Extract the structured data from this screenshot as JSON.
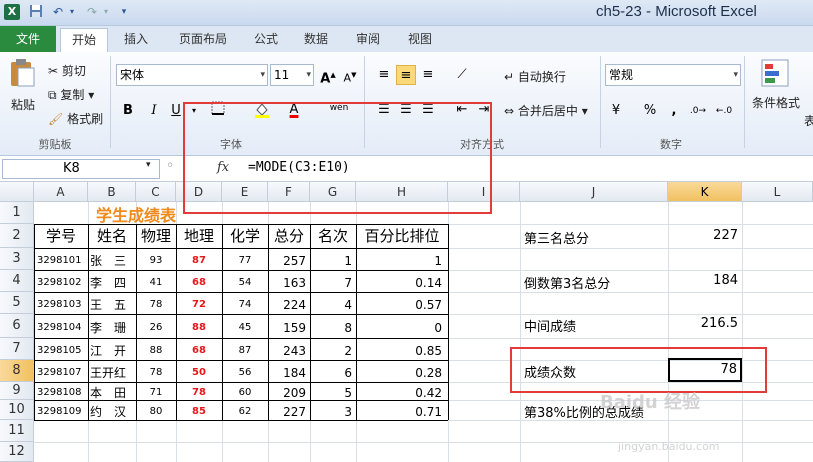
{
  "window": {
    "title": "ch5-23 - Microsoft Excel"
  },
  "tabs": [
    "文件",
    "开始",
    "插入",
    "页面布局",
    "公式",
    "数据",
    "审阅",
    "视图"
  ],
  "ribbon": {
    "clipboard": {
      "paste": "粘贴",
      "cut": "剪切",
      "copy": "复制",
      "format_painter": "格式刷",
      "label": "剪贴板"
    },
    "font": {
      "name": "宋体",
      "size": "11",
      "label": "字体",
      "bold": "B",
      "italic": "I",
      "underline": "U",
      "grow": "A",
      "shrink": "A",
      "font_color": "A",
      "phonetic": "wén"
    },
    "alignment": {
      "wrap": "自动换行",
      "merge": "合并后居中",
      "label": "对齐方式"
    },
    "number": {
      "format": "常规",
      "percent": "%",
      "comma": ",",
      "label": "数字"
    },
    "styles": {
      "conditional": "条件格式",
      "label": "表"
    }
  },
  "formula_bar": {
    "name_box": "K8",
    "fx": "fx",
    "formula": "=MODE(C3:E10)"
  },
  "columns": [
    "A",
    "B",
    "C",
    "D",
    "E",
    "F",
    "G",
    "H",
    "I",
    "J",
    "K",
    "L"
  ],
  "rows": [
    "1",
    "2",
    "3",
    "4",
    "5",
    "6",
    "7",
    "8",
    "9",
    "10",
    "11",
    "12"
  ],
  "sheet": {
    "title": "学生成绩表",
    "headers": [
      "学号",
      "姓名",
      "物理",
      "地理",
      "化学",
      "总分",
      "名次",
      "百分比排位"
    ],
    "records": [
      {
        "id": "3298101",
        "name": "张　三",
        "physics": "93",
        "geo": "87",
        "chem": "77",
        "total": "257",
        "rank": "1",
        "pct": "1"
      },
      {
        "id": "3298102",
        "name": "李　四",
        "physics": "41",
        "geo": "68",
        "chem": "54",
        "total": "163",
        "rank": "7",
        "pct": "0.14"
      },
      {
        "id": "3298103",
        "name": "王　五",
        "physics": "78",
        "geo": "72",
        "chem": "74",
        "total": "224",
        "rank": "4",
        "pct": "0.57"
      },
      {
        "id": "3298104",
        "name": "李　珊",
        "physics": "26",
        "geo": "88",
        "chem": "45",
        "total": "159",
        "rank": "8",
        "pct": "0"
      },
      {
        "id": "3298105",
        "name": "江　开",
        "physics": "88",
        "geo": "68",
        "chem": "87",
        "total": "243",
        "rank": "2",
        "pct": "0.85"
      },
      {
        "id": "3298107",
        "name": "王开红",
        "physics": "78",
        "geo": "50",
        "chem": "56",
        "total": "184",
        "rank": "6",
        "pct": "0.28"
      },
      {
        "id": "3298108",
        "name": "本　田",
        "physics": "71",
        "geo": "78",
        "chem": "60",
        "total": "209",
        "rank": "5",
        "pct": "0.42"
      },
      {
        "id": "3298109",
        "name": "约　汉",
        "physics": "80",
        "geo": "85",
        "chem": "62",
        "total": "227",
        "rank": "3",
        "pct": "0.71"
      }
    ],
    "stats": [
      {
        "label": "第三名总分",
        "value": "227"
      },
      {
        "label": "倒数第3名总分",
        "value": "184"
      },
      {
        "label": "中间成绩",
        "value": "216.5"
      },
      {
        "label": "成绩众数",
        "value": "78"
      },
      {
        "label": "第38%比例的总成绩",
        "value": ""
      }
    ]
  },
  "watermark": {
    "text": "Baidu 经验",
    "url": "jingyan.baidu.com"
  },
  "colors": {
    "accent_green": "#2a8a3e",
    "highlight_red": "#e33a3a",
    "title_orange": "#f08a1c"
  }
}
